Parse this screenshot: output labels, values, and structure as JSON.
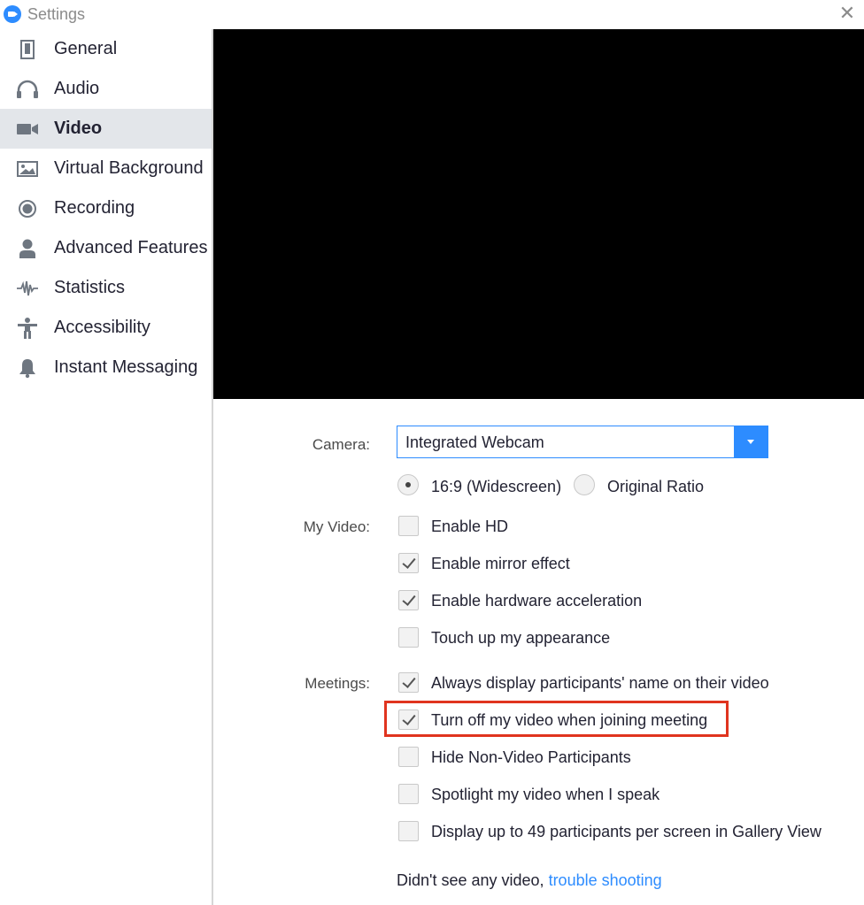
{
  "window": {
    "title": "Settings",
    "close_icon": "close-icon"
  },
  "sidebar": {
    "items": [
      {
        "label": "General",
        "icon": "general-icon",
        "active": false
      },
      {
        "label": "Audio",
        "icon": "headphones-icon",
        "active": false
      },
      {
        "label": "Video",
        "icon": "video-camera-icon",
        "active": true
      },
      {
        "label": "Virtual Background",
        "icon": "image-icon",
        "active": false
      },
      {
        "label": "Recording",
        "icon": "record-icon",
        "active": false
      },
      {
        "label": "Advanced Features",
        "icon": "user-icon",
        "active": false
      },
      {
        "label": "Statistics",
        "icon": "waveform-icon",
        "active": false
      },
      {
        "label": "Accessibility",
        "icon": "accessibility-icon",
        "active": false
      },
      {
        "label": "Instant Messaging",
        "icon": "bell-icon",
        "active": false
      }
    ]
  },
  "video": {
    "camera_label": "Camera:",
    "camera_value": "Integrated Webcam",
    "ratio": {
      "widescreen_label": "16:9 (Widescreen)",
      "original_label": "Original Ratio",
      "selected": "16:9 (Widescreen)"
    },
    "my_video_label": "My Video:",
    "my_video_options": [
      {
        "label": "Enable HD",
        "checked": false
      },
      {
        "label": "Enable mirror effect",
        "checked": true
      },
      {
        "label": "Enable hardware acceleration",
        "checked": true
      },
      {
        "label": "Touch up my appearance",
        "checked": false
      }
    ],
    "meetings_label": "Meetings:",
    "meetings_options": [
      {
        "label": "Always display participants' name on their video",
        "checked": true
      },
      {
        "label": "Turn off my video when joining meeting",
        "checked": true,
        "highlighted": true
      },
      {
        "label": "Hide Non-Video Participants",
        "checked": false
      },
      {
        "label": "Spotlight my video when I speak",
        "checked": false
      },
      {
        "label": "Display up to 49 participants per screen in Gallery View",
        "checked": false
      }
    ],
    "footer_text": "Didn't see any video,",
    "footer_link": "trouble shooting"
  },
  "colors": {
    "accent": "#2d8cff",
    "highlight": "#e0341f",
    "active_bg": "#e3e6ea"
  }
}
